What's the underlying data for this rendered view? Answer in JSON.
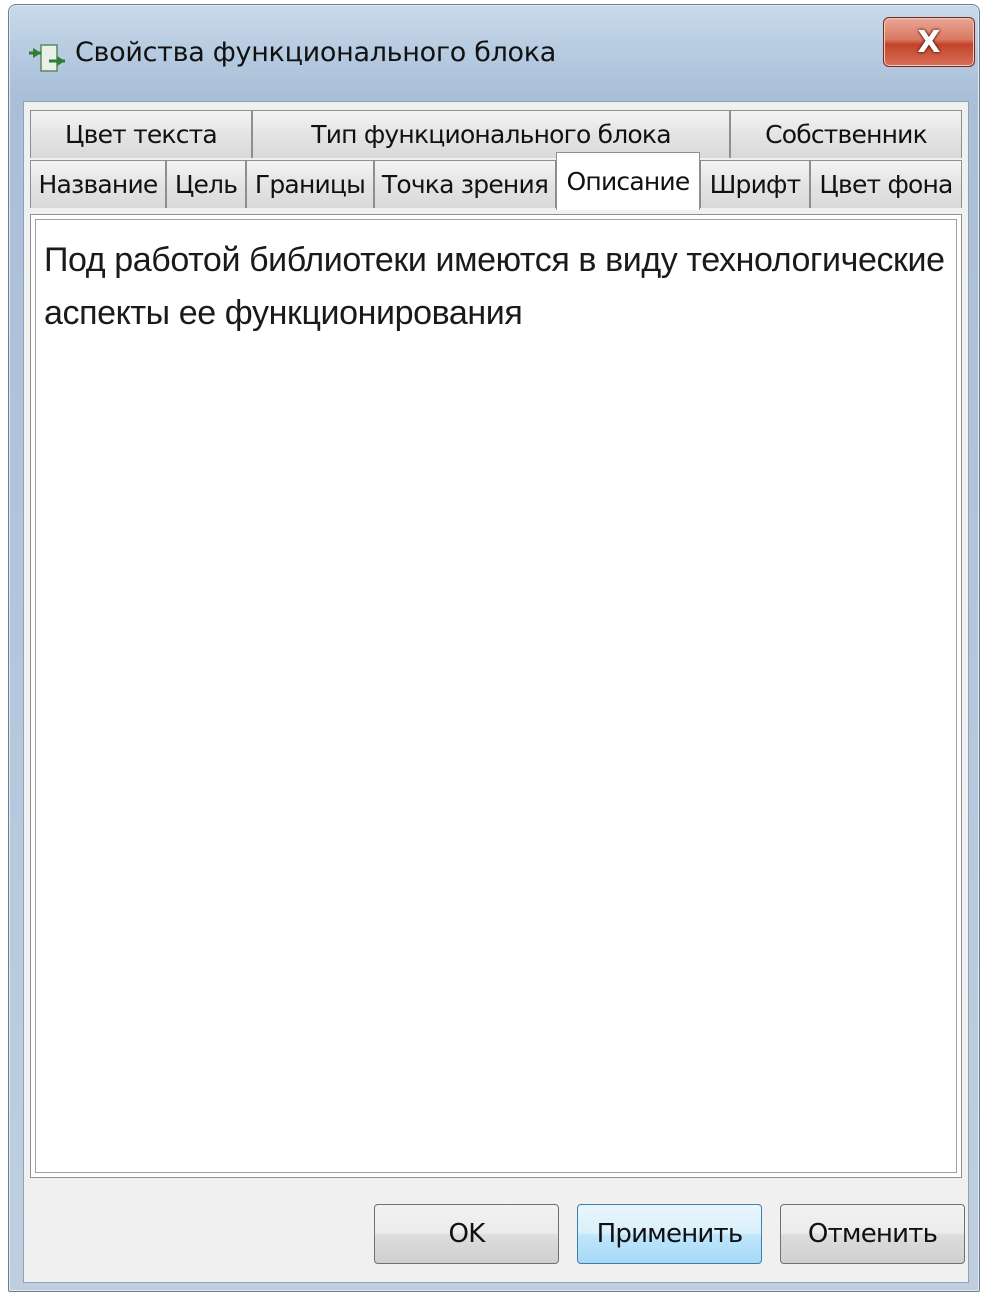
{
  "window": {
    "title": "Свойства функционального блока",
    "close_label": "X"
  },
  "tabs": {
    "row1": [
      {
        "label": "Цвет текста"
      },
      {
        "label": "Тип функционального блока"
      },
      {
        "label": "Собственник"
      }
    ],
    "row2": [
      {
        "label": "Название"
      },
      {
        "label": "Цель"
      },
      {
        "label": "Границы"
      },
      {
        "label": "Точка зрения"
      },
      {
        "label": "Описание",
        "active": true
      },
      {
        "label": "Шрифт"
      },
      {
        "label": "Цвет фона"
      }
    ]
  },
  "description": {
    "text": "Под работой библиотеки имеются в виду технологические аспекты ее функционирования"
  },
  "buttons": {
    "ok": "OK",
    "apply": "Применить",
    "cancel": "Отменить"
  }
}
